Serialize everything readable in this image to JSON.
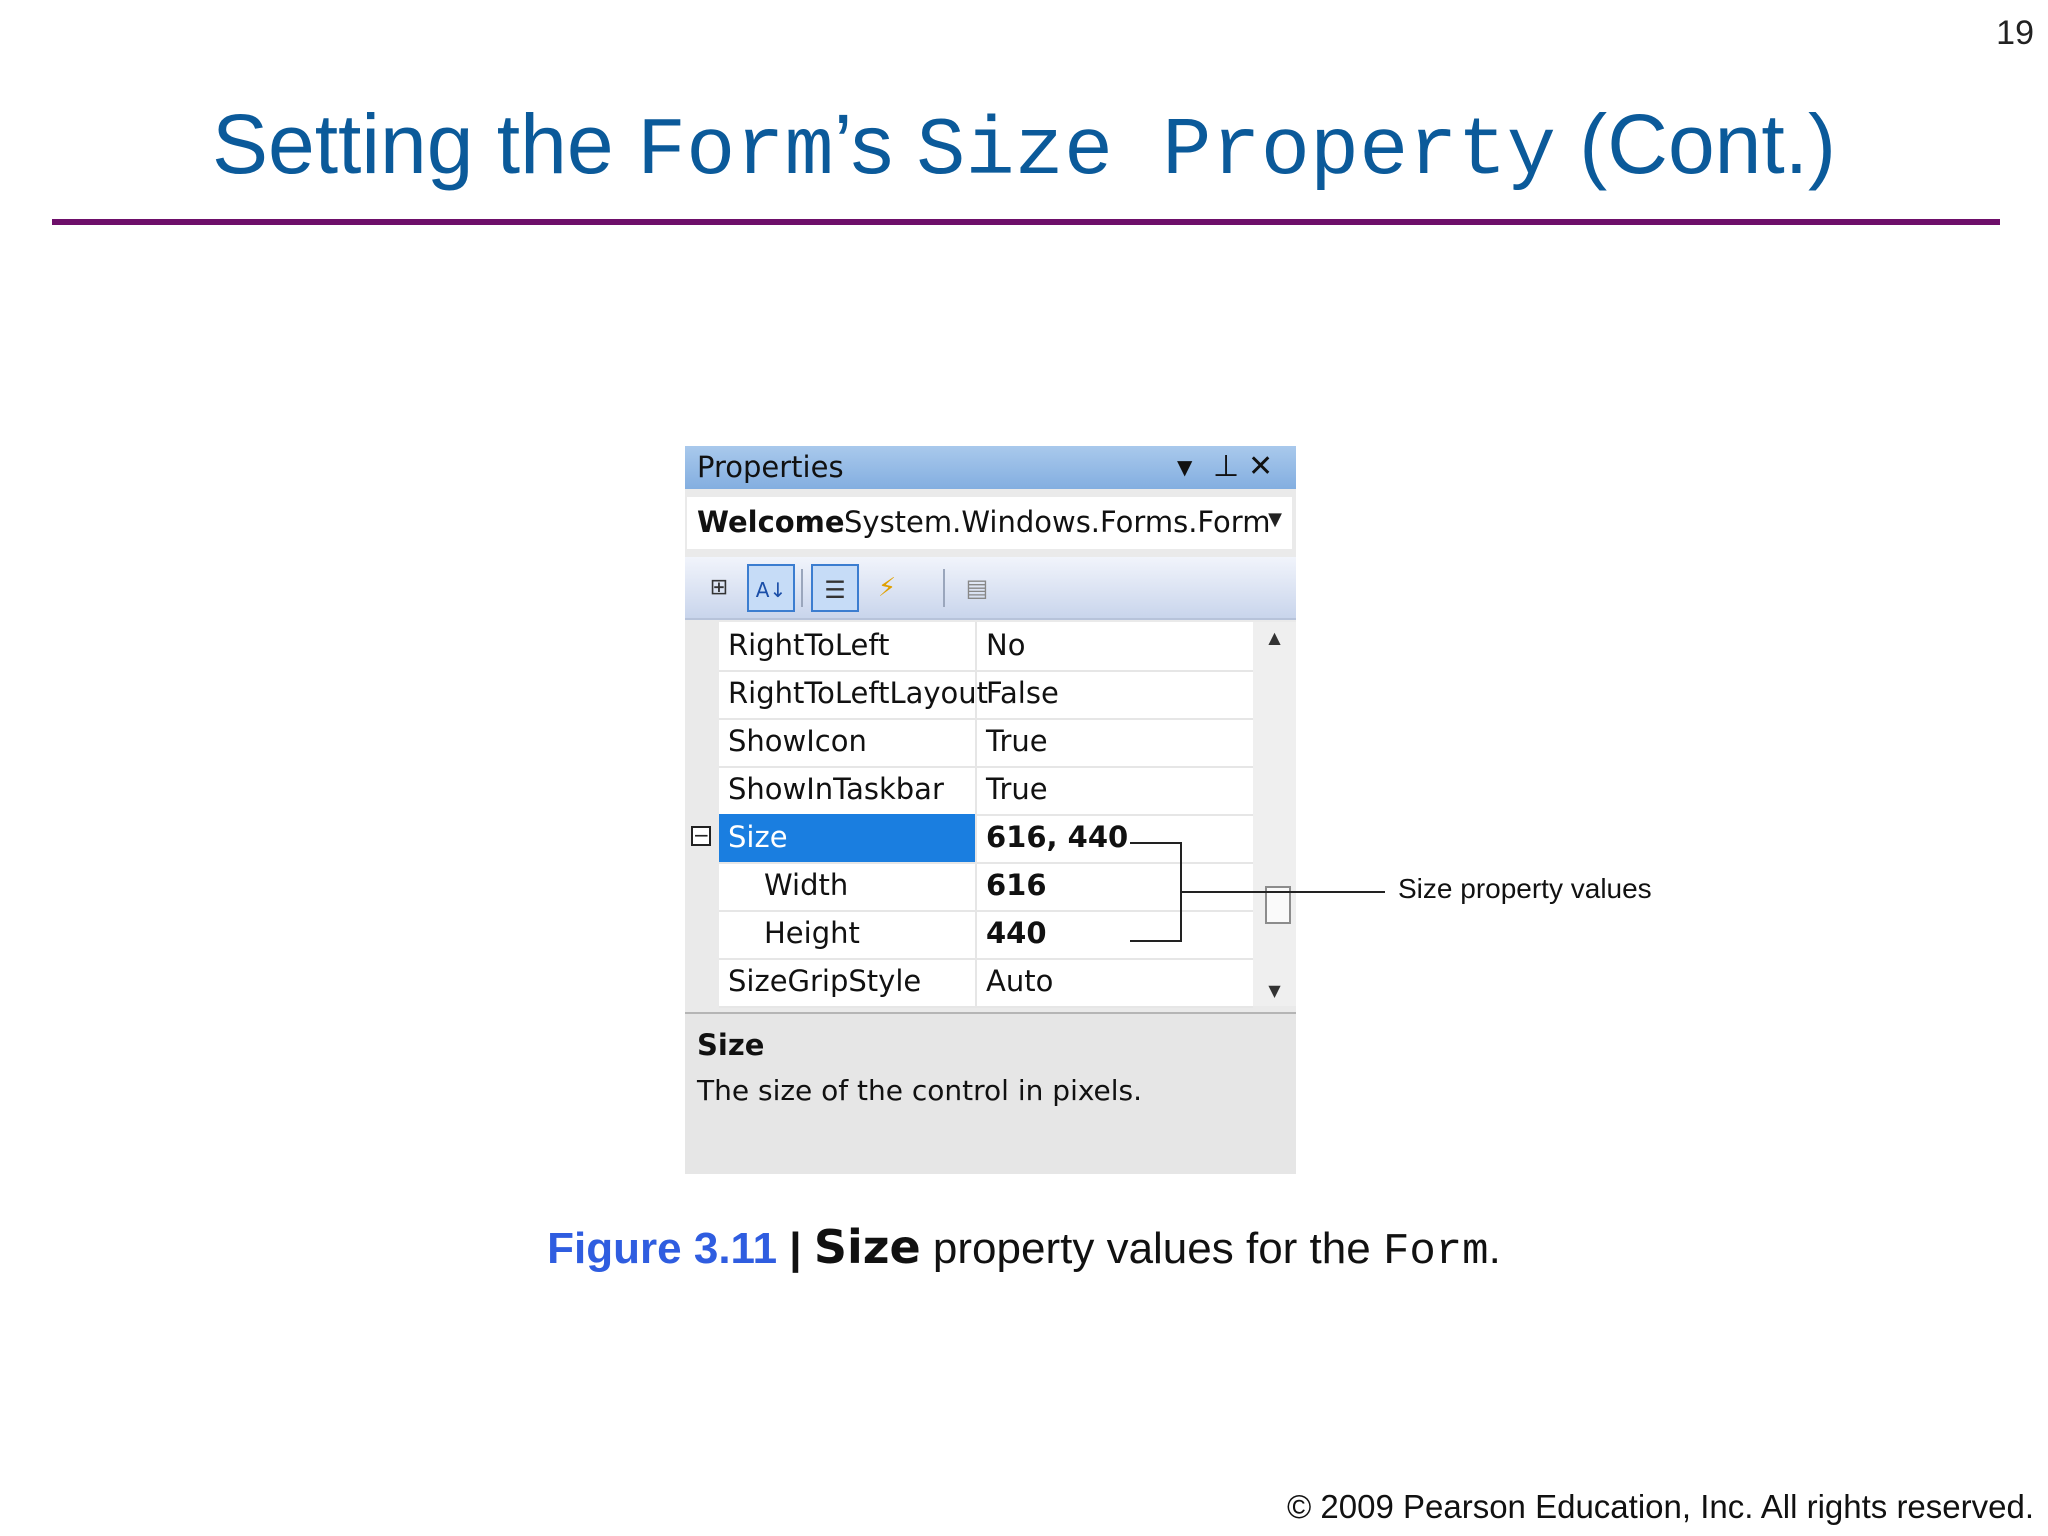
{
  "slide": {
    "number": "19",
    "title": {
      "part1": "Setting the ",
      "code1": "Form",
      "part2": "’s ",
      "code2": "Size Property",
      "part3": " (Cont.)"
    },
    "copyright": "© 2009 Pearson Education, Inc.  All rights reserved."
  },
  "properties_window": {
    "title": "Properties",
    "title_icons": [
      "dropdown-arrow-icon",
      "pin-icon",
      "close-icon"
    ],
    "object_name": "Welcome",
    "object_type": "System.Windows.Forms.Form",
    "toolbar": [
      "categorized-icon",
      "alphabetical-icon",
      "properties-icon",
      "events-icon",
      "property-pages-icon"
    ],
    "rows": [
      {
        "name": "RightToLeft",
        "value": "No"
      },
      {
        "name": "RightToLeftLayout",
        "value": "False"
      },
      {
        "name": "ShowIcon",
        "value": "True"
      },
      {
        "name": "ShowInTaskbar",
        "value": "True"
      },
      {
        "name": "Size",
        "value": "616, 440"
      },
      {
        "name": "Width",
        "value": "616"
      },
      {
        "name": "Height",
        "value": "440"
      },
      {
        "name": "SizeGripStyle",
        "value": "Auto"
      }
    ],
    "selected_row": "Size",
    "description_title": "Size",
    "description_text": "The size of the control in pixels."
  },
  "callout": "Size property values",
  "caption": {
    "label": "Figure 3.11",
    "separator": " | ",
    "prop": "Size",
    "text": " property values for the ",
    "code": "Form",
    "end": "."
  }
}
